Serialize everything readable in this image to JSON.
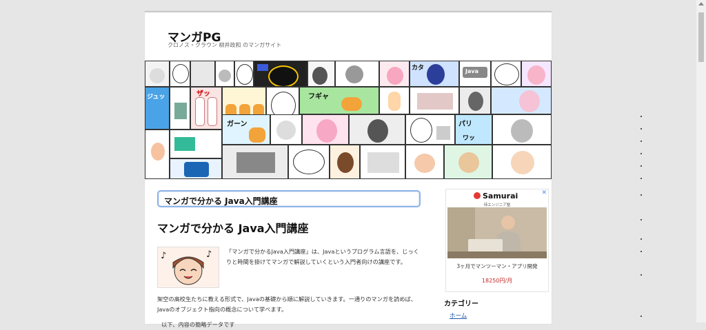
{
  "header": {
    "site_title": "マンガPG",
    "site_description": "クロノス・クラウン 柳井政和 のマンガサイト"
  },
  "banner": {
    "sfx": [
      "カタ",
      "ジュッ",
      "ザッ",
      "ガーン",
      "フギャ",
      "パリ",
      "ワッ"
    ],
    "java_label": "Java"
  },
  "main": {
    "box_title": "マンガで分かる Java入門講座",
    "article_title": "マンガで分かる Java入門講座",
    "intro": "「マンガで分かるJava入門講座」は、Javaというプログラム言語を、じっくりと時間を掛けてマンガで解説していくという入門者向けの講座です。",
    "paragraph": "架空の高校生たちに教える形式で、Javaの基礎から順に解説していきます。一通りのマンガを読めば、Javaのオブジェクト指向の概念について学べます。",
    "paragraph2": "以下、内容の簡略データです"
  },
  "ad": {
    "brand": "Samurai",
    "sub": "侍エンジニア塾",
    "tagline": "3ヶ月でマンツーマン・アプリ開発",
    "price": "18250円/月",
    "close": "✕"
  },
  "sidebar": {
    "category_title": "カテゴリー",
    "links": [
      "ホーム"
    ]
  },
  "colors": {
    "box_border": "#8fb3e6",
    "link": "#1a55b0",
    "ad_accent": "#e53935"
  }
}
